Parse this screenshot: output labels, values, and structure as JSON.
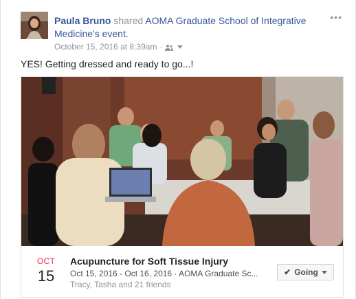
{
  "post": {
    "author": "Paula Bruno",
    "action_text": "shared",
    "page_name": "AOMA Graduate School of Integrative Medicine",
    "page_suffix": "'s event.",
    "timestamp": "October 15, 2016 at 8:39am",
    "separator": "·",
    "privacy_icon": "friends-icon",
    "options_icon": "more-options-icon",
    "text": "YES! Getting dressed and ready to go...!"
  },
  "event": {
    "month": "OCT",
    "day": "15",
    "title": "Acupuncture for Soft Tissue Injury",
    "details": "Oct 15, 2016 - Oct 16, 2016 · AOMA Graduate Sc...",
    "friends": "Tracy, Tasha and 21 friends",
    "rsvp_label": "Going",
    "rsvp_icon": "check-icon"
  },
  "colors": {
    "link": "#365899",
    "month": "#f02849",
    "muted": "#90949c"
  }
}
